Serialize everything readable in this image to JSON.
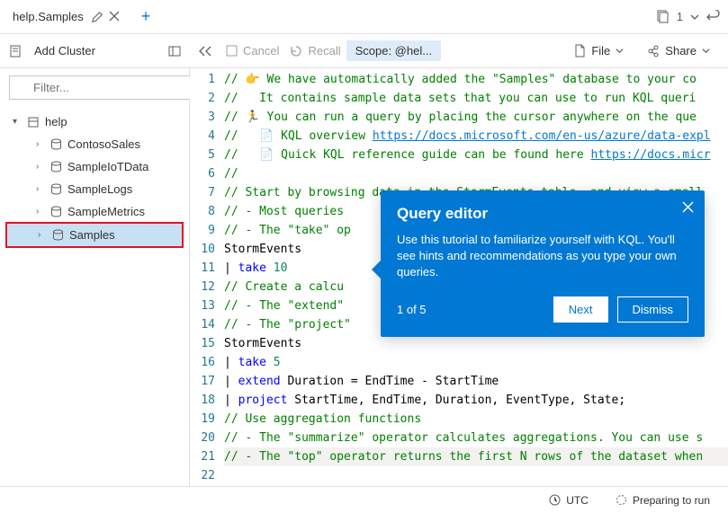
{
  "tab": {
    "title": "help.Samples"
  },
  "topbarRight": {
    "copyCount": "1"
  },
  "sideHeader": {
    "addCluster": "Add Cluster"
  },
  "toolbar": {
    "cancel": "Cancel",
    "recall": "Recall",
    "scope": "Scope: @hel...",
    "file": "File",
    "share": "Share"
  },
  "filter": {
    "placeholder": "Filter..."
  },
  "tree": {
    "root": "help",
    "items": [
      {
        "label": "ContosoSales"
      },
      {
        "label": "SampleIoTData"
      },
      {
        "label": "SampleLogs"
      },
      {
        "label": "SampleMetrics"
      },
      {
        "label": "Samples"
      }
    ]
  },
  "code": {
    "lines": [
      "// 👉 We have automatically added the \"Samples\" database to your co",
      "//   It contains sample data sets that you can use to run KQL queri",
      "// 🏃 You can run a query by placing the cursor anywhere on the que",
      "//   📄 KQL overview https://docs.microsoft.com/en-us/azure/data-expl",
      "//   📄 Quick KQL reference guide can be found here https://docs.micr",
      "//",
      "// Start by browsing data in the StormEvents table, and view a small",
      "// - Most queries",
      "// - The \"take\" op",
      "StormEvents",
      "| take 10",
      "",
      "// Create a calcu",
      "// - The \"extend\"",
      "// - The \"project\"",
      "StormEvents",
      "| take 5",
      "| extend Duration = EndTime - StartTime",
      "| project StartTime, EndTime, Duration, EventType, State;",
      "",
      "// Use aggregation functions",
      "// - The \"summarize\" operator calculates aggregations. You can use s",
      "// - The \"top\" operator returns the first N rows of the dataset when"
    ]
  },
  "tooltip": {
    "title": "Query editor",
    "body": "Use this tutorial to familiarize yourself with KQL. You'll see hints and recommendations as you type your own queries.",
    "step": "1 of 5",
    "next": "Next",
    "dismiss": "Dismiss"
  },
  "status": {
    "utc": "UTC",
    "state": "Preparing to run"
  }
}
